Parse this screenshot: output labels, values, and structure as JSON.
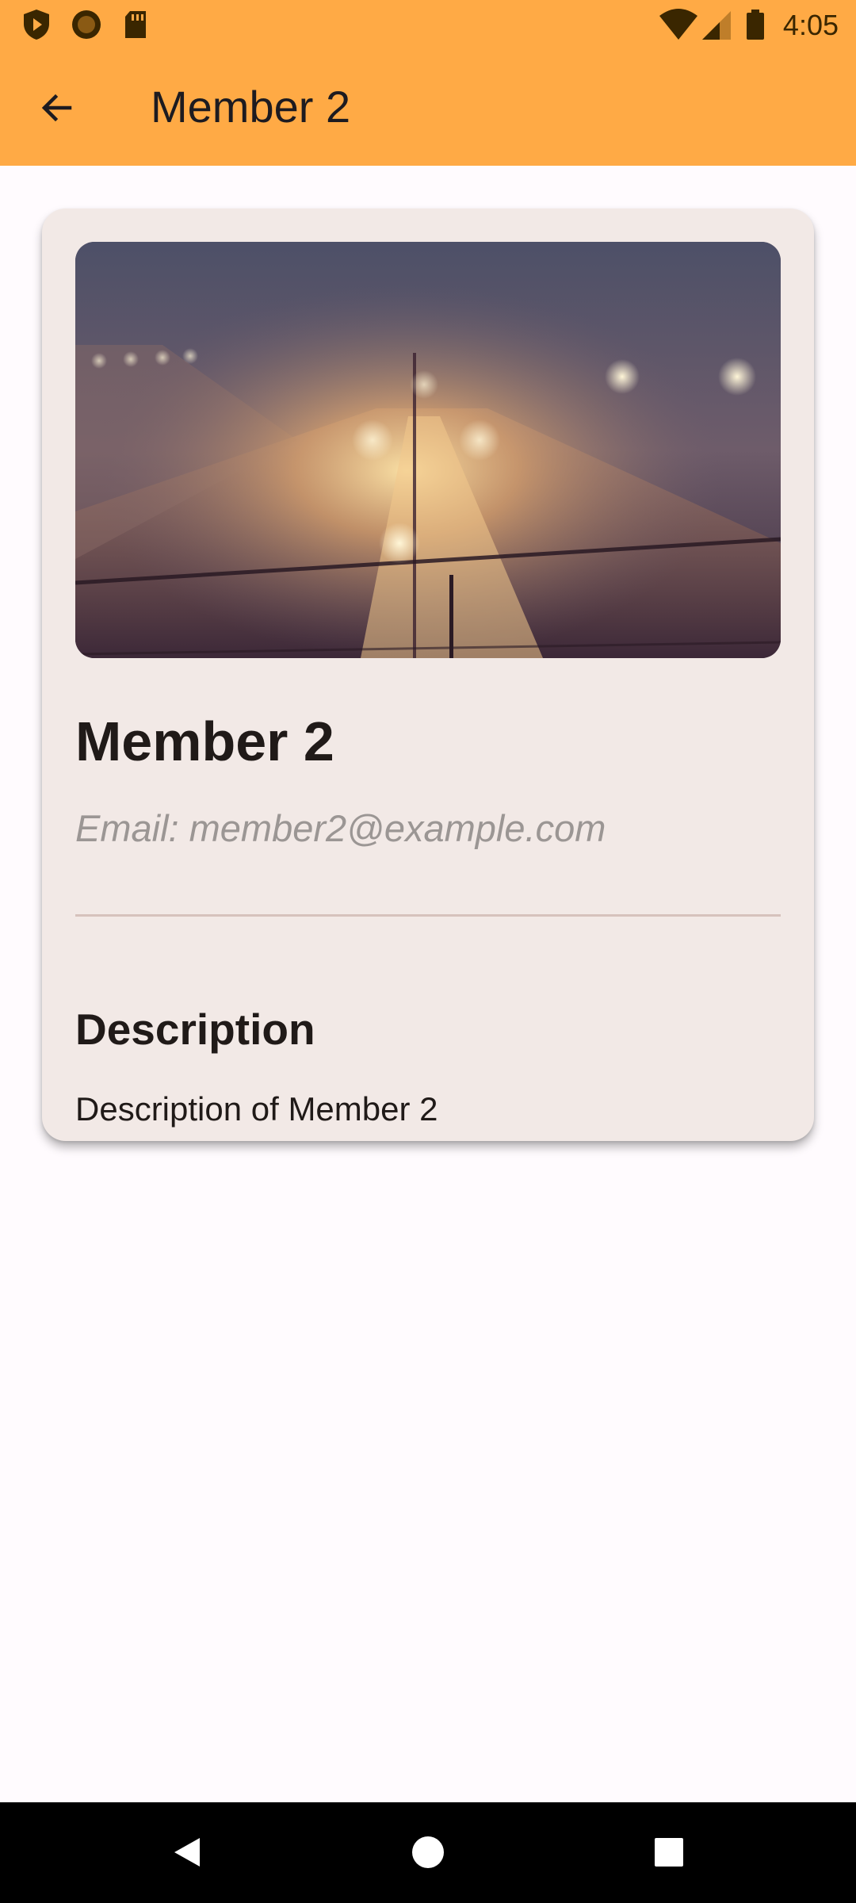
{
  "status_bar": {
    "time": "4:05",
    "left_icons": [
      "shield-play-icon",
      "circle-record-icon",
      "sd-card-icon"
    ],
    "right_icons": [
      "wifi-icon",
      "cell-signal-icon",
      "battery-icon"
    ]
  },
  "app_bar": {
    "title": "Member 2",
    "back_icon": "arrow-back-icon",
    "background_color": "#FFAA45"
  },
  "member_card": {
    "name": "Member 2",
    "email": "Email: member2@example.com",
    "description_heading": "Description",
    "description": "Description of Member 2",
    "background_color": "#F2E9E6"
  },
  "nav_bar": {
    "buttons": [
      "back-triangle-icon",
      "home-circle-icon",
      "recents-square-icon"
    ]
  }
}
